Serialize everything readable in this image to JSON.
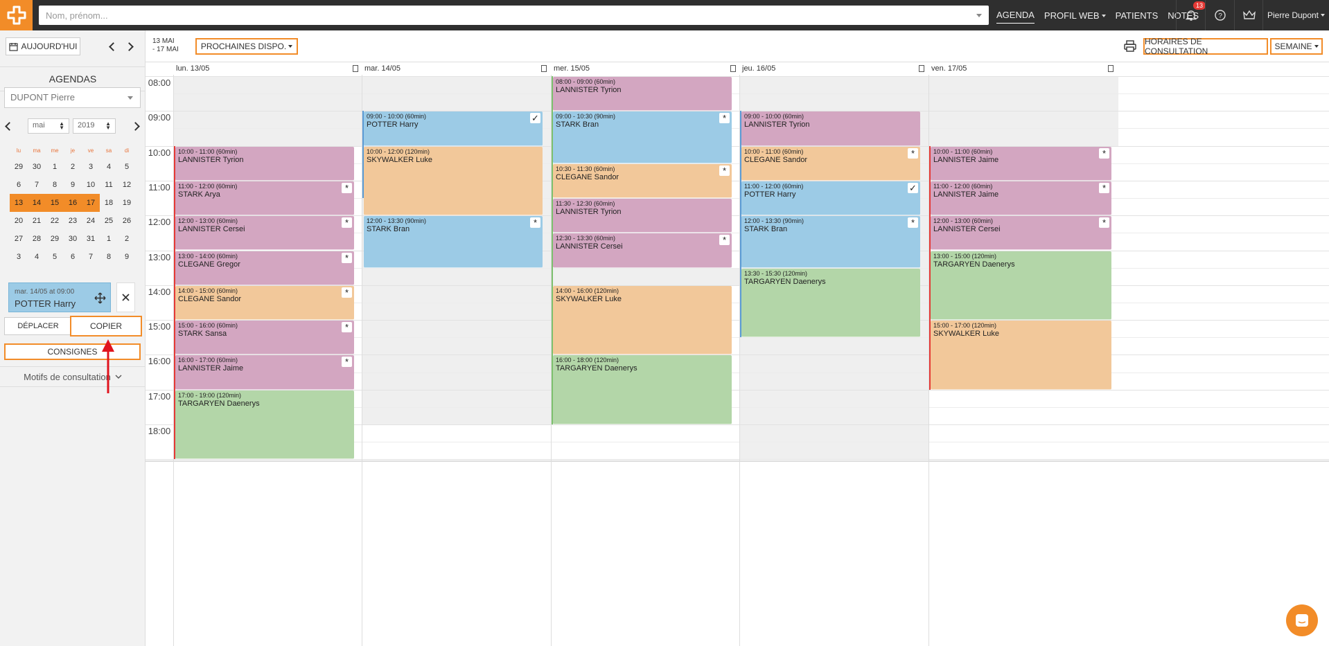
{
  "topbar": {
    "search_placeholder": "Nom, prénom...",
    "nav": [
      "AGENDA",
      "PROFIL WEB",
      "PATIENTS",
      "NOTES"
    ],
    "notifications_count": "13",
    "user": "Pierre Dupont"
  },
  "sidebar": {
    "today_label": "AUJOURD'HUI",
    "agendas_title": "AGENDAS",
    "doctor": "DUPONT Pierre",
    "month": "mai",
    "year": "2019",
    "weekday_headers": [
      "lu",
      "ma",
      "me",
      "je",
      "ve",
      "sa",
      "di"
    ],
    "weeks": [
      [
        "29",
        "30",
        "1",
        "2",
        "3",
        "4",
        "5"
      ],
      [
        "6",
        "7",
        "8",
        "9",
        "10",
        "11",
        "12"
      ],
      [
        "13",
        "14",
        "15",
        "16",
        "17",
        "18",
        "19"
      ],
      [
        "20",
        "21",
        "22",
        "23",
        "24",
        "25",
        "26"
      ],
      [
        "27",
        "28",
        "29",
        "30",
        "31",
        "1",
        "2"
      ],
      [
        "3",
        "4",
        "5",
        "6",
        "7",
        "8",
        "9"
      ]
    ],
    "clipboard_slot": "mar. 14/05 at 09:00",
    "clipboard_name": "POTTER Harry",
    "move_label": "DÉPLACER",
    "copy_label": "COPIER",
    "instructions_label": "CONSIGNES",
    "motifs_label": "Motifs de consultation"
  },
  "toolbar": {
    "range_line1": "13 MAI",
    "range_line2": "- 17 MAI",
    "next_availability": "PROCHAINES DISPO.",
    "consultation_hours": "HORAIRES DE CONSULTATION",
    "view": "SEMAINE"
  },
  "days": [
    "lun. 13/05",
    "mar. 14/05",
    "mer. 15/05",
    "jeu. 16/05",
    "ven. 17/05"
  ],
  "hours": [
    "08:00",
    "09:00",
    "10:00",
    "11:00",
    "12:00",
    "13:00",
    "14:00",
    "15:00",
    "16:00",
    "17:00",
    "18:00"
  ],
  "appointments": [
    {
      "day": 0,
      "time": "10:00 - 11:00 (60min)",
      "name": "LANNISTER Tyrion",
      "color": "pk",
      "badge": ""
    },
    {
      "day": 0,
      "time": "11:00 - 12:00 (60min)",
      "name": "STARK Arya",
      "color": "pk",
      "badge": "*"
    },
    {
      "day": 0,
      "time": "12:00 - 13:00 (60min)",
      "name": "LANNISTER Cersei",
      "color": "pk",
      "badge": "*"
    },
    {
      "day": 0,
      "time": "13:00 - 14:00 (60min)",
      "name": "CLEGANE Gregor",
      "color": "pk",
      "badge": "*"
    },
    {
      "day": 0,
      "time": "14:00 - 15:00 (60min)",
      "name": "CLEGANE Sandor",
      "color": "or",
      "badge": "*"
    },
    {
      "day": 0,
      "time": "15:00 - 16:00 (60min)",
      "name": "STARK Sansa",
      "color": "pk",
      "badge": "*"
    },
    {
      "day": 0,
      "time": "16:00 - 17:00 (60min)",
      "name": "LANNISTER Jaime",
      "color": "pk",
      "badge": "*"
    },
    {
      "day": 0,
      "time": "17:00 - 19:00 (120min)",
      "name": "TARGARYEN Daenerys",
      "color": "gr",
      "badge": ""
    },
    {
      "day": 1,
      "time": "09:00 - 10:00 (60min)",
      "name": "POTTER Harry",
      "color": "bl",
      "badge": "✓"
    },
    {
      "day": 1,
      "time": "10:00 - 12:00 (120min)",
      "name": "SKYWALKER Luke",
      "color": "or",
      "badge": ""
    },
    {
      "day": 1,
      "time": "12:00 - 13:30 (90min)",
      "name": "STARK Bran",
      "color": "bl",
      "badge": "*"
    },
    {
      "day": 2,
      "time": "08:00 - 09:00 (60min)",
      "name": "LANNISTER Tyrion",
      "color": "pk",
      "badge": ""
    },
    {
      "day": 2,
      "time": "09:00 - 10:30 (90min)",
      "name": "STARK Bran",
      "color": "bl",
      "badge": "*"
    },
    {
      "day": 2,
      "time": "10:30 - 11:30 (60min)",
      "name": "CLEGANE Sandor",
      "color": "or",
      "badge": "*"
    },
    {
      "day": 2,
      "time": "11:30 - 12:30 (60min)",
      "name": "LANNISTER Tyrion",
      "color": "pk",
      "badge": ""
    },
    {
      "day": 2,
      "time": "12:30 - 13:30 (60min)",
      "name": "LANNISTER Cersei",
      "color": "pk",
      "badge": "*"
    },
    {
      "day": 2,
      "time": "14:00 - 16:00 (120min)",
      "name": "SKYWALKER Luke",
      "color": "or",
      "badge": ""
    },
    {
      "day": 2,
      "time": "16:00 - 18:00 (120min)",
      "name": "TARGARYEN Daenerys",
      "color": "gr",
      "badge": ""
    },
    {
      "day": 3,
      "time": "09:00 - 10:00 (60min)",
      "name": "LANNISTER Tyrion",
      "color": "pk",
      "badge": ""
    },
    {
      "day": 3,
      "time": "10:00 - 11:00 (60min)",
      "name": "CLEGANE Sandor",
      "color": "or",
      "badge": "*"
    },
    {
      "day": 3,
      "time": "11:00 - 12:00 (60min)",
      "name": "POTTER Harry",
      "color": "bl",
      "badge": "✓"
    },
    {
      "day": 3,
      "time": "12:00 - 13:30 (90min)",
      "name": "STARK Bran",
      "color": "bl",
      "badge": "*"
    },
    {
      "day": 3,
      "time": "13:30 - 15:30 (120min)",
      "name": "TARGARYEN Daenerys",
      "color": "gr",
      "badge": ""
    },
    {
      "day": 4,
      "time": "10:00 - 11:00 (60min)",
      "name": "LANNISTER Jaime",
      "color": "pk",
      "badge": "*"
    },
    {
      "day": 4,
      "time": "11:00 - 12:00 (60min)",
      "name": "LANNISTER Jaime",
      "color": "pk",
      "badge": "*"
    },
    {
      "day": 4,
      "time": "12:00 - 13:00 (60min)",
      "name": "LANNISTER Cersei",
      "color": "pk",
      "badge": "*"
    },
    {
      "day": 4,
      "time": "13:00 - 15:00 (120min)",
      "name": "TARGARYEN Daenerys",
      "color": "gr",
      "badge": ""
    },
    {
      "day": 4,
      "time": "15:00 - 17:00 (120min)",
      "name": "SKYWALKER Luke",
      "color": "or",
      "badge": ""
    }
  ],
  "colors": {
    "accent": "#f28c28",
    "topbar": "#2f2f2f",
    "pink": "#d3a6c1",
    "blue": "#9ccbe6",
    "orange": "#f2c89a",
    "green": "#b3d6a8"
  }
}
